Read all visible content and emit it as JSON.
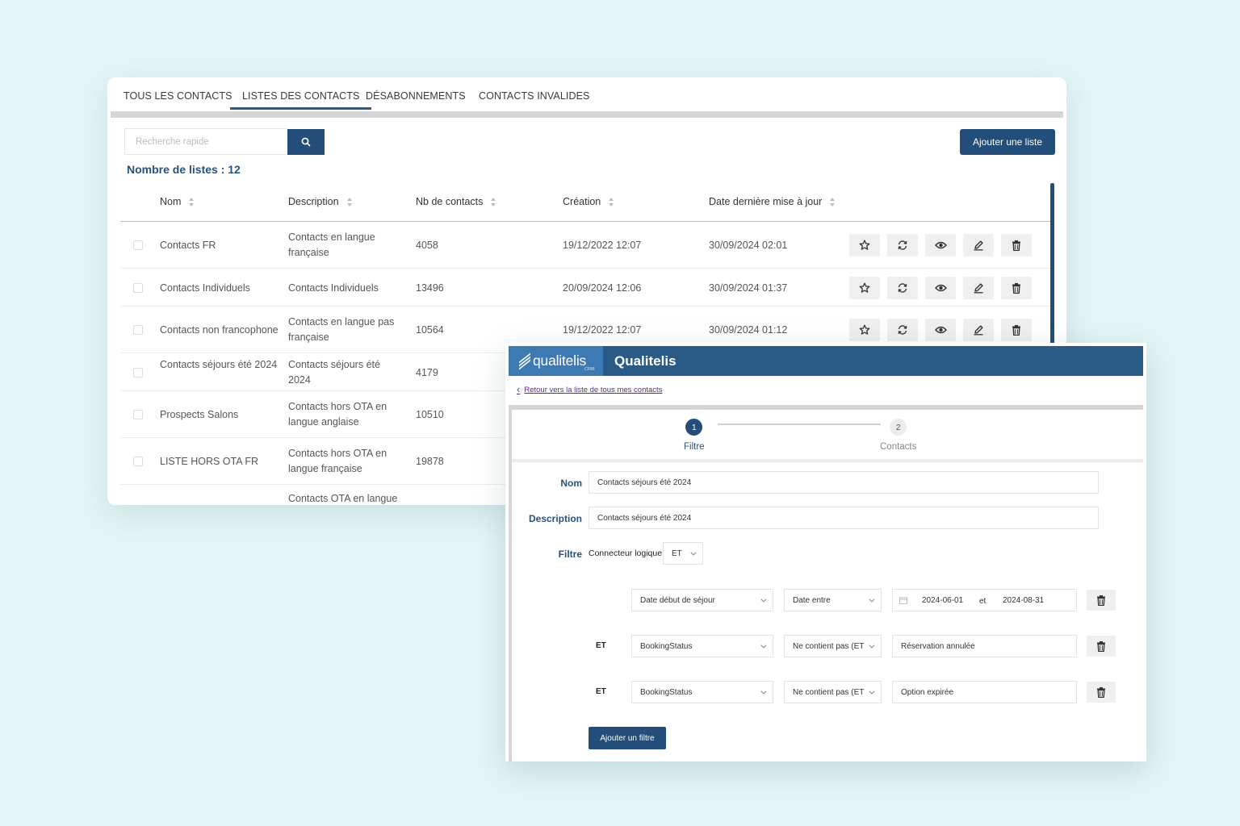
{
  "list_panel": {
    "tabs": [
      "TOUS LES CONTACTS",
      "LISTES DES CONTACTS",
      "DÉSABONNEMENTS",
      "CONTACTS INVALIDES"
    ],
    "active_tab": 1,
    "search_placeholder": "Recherche rapide",
    "add_list_label": "Ajouter une liste",
    "count_text": "Nombre de listes : 12",
    "columns": [
      "Nom",
      "Description",
      "Nb de contacts",
      "Création",
      "Date dernière mise à jour"
    ],
    "rows": [
      {
        "name": "Contacts FR",
        "description": "Contacts en langue française",
        "count": "4058",
        "created": "19/12/2022 12:07",
        "updated": "30/09/2024 02:01"
      },
      {
        "name": "Contacts Individuels",
        "description": "Contacts Individuels",
        "count": "13496",
        "created": "20/09/2024 12:06",
        "updated": "30/09/2024 01:37"
      },
      {
        "name": "Contacts non francophone",
        "description": "Contacts en langue pas française",
        "count": "10564",
        "created": "19/12/2022 12:07",
        "updated": "30/09/2024 01:12"
      },
      {
        "name": "Contacts séjours été 2024",
        "description": "Contacts séjours été 2024",
        "count": "4179"
      },
      {
        "name": "Prospects Salons",
        "description": "Contacts hors OTA en langue anglaise",
        "count": "10510"
      },
      {
        "name": "LISTE HORS OTA FR",
        "description": "Contacts hors OTA en langue française",
        "count": "19878"
      },
      {
        "name": "",
        "description": "Contacts OTA en langue",
        "count": ""
      }
    ],
    "row_actions": [
      "star-icon",
      "refresh-icon",
      "eye-icon",
      "edit-icon",
      "trash-icon"
    ]
  },
  "editor": {
    "logo_text": "qualitelis",
    "logo_sub": "CRM",
    "app_title": "Qualitelis",
    "back_link": "Retour vers la liste de tous mes contacts",
    "steps": [
      {
        "number": "1",
        "label": "Filtre"
      },
      {
        "number": "2",
        "label": "Contacts"
      }
    ],
    "nom_label": "Nom",
    "nom_value": "Contacts séjours été 2024",
    "description_label": "Description",
    "description_value": "Contacts séjours été 2024",
    "filtre_label": "Filtre",
    "connector_label": "Connecteur logique",
    "connector_value": "ET",
    "filters": [
      {
        "connector": "",
        "field": "Date début de séjour",
        "operator": "Date entre",
        "from": "2024-06-01",
        "between": "et",
        "to": "2024-08-31"
      },
      {
        "connector": "ET",
        "field": "BookingStatus",
        "operator": "Ne contient pas (ET",
        "value": "Réservation annulée"
      },
      {
        "connector": "ET",
        "field": "BookingStatus",
        "operator": "Ne contient pas (ET",
        "value": "Option expirée"
      }
    ],
    "add_filter_label": "Ajouter un filtre"
  },
  "colors": {
    "primary": "#234e7a",
    "header": "#2a5a86",
    "logo_bg": "#3d7ab4",
    "background": "#e3f5f4"
  }
}
